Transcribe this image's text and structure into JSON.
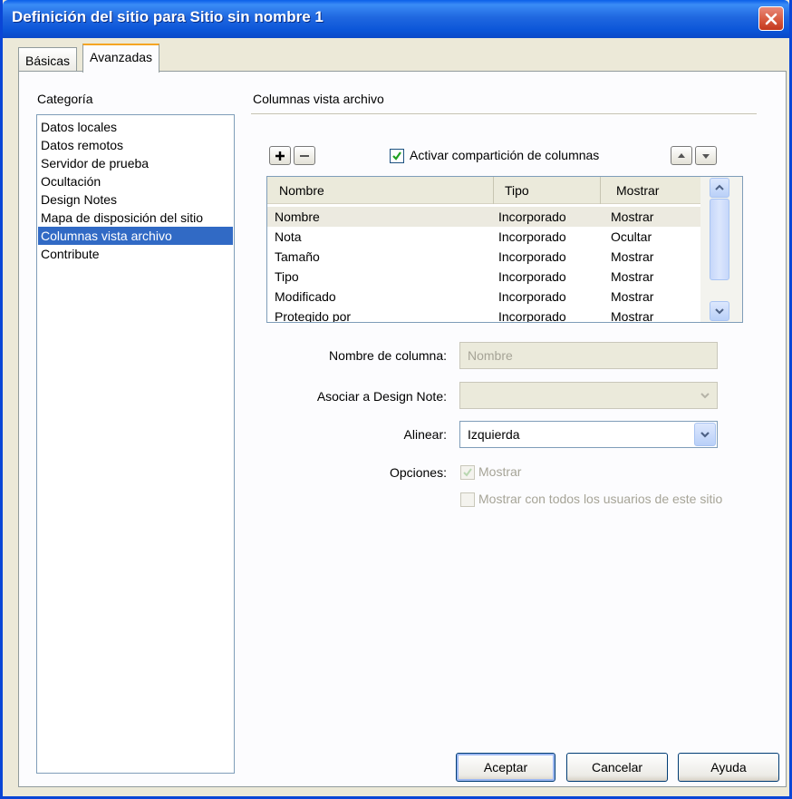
{
  "window": {
    "title": "Definición del sitio para Sitio sin nombre 1"
  },
  "tabs": [
    {
      "label": "Básicas",
      "active": false
    },
    {
      "label": "Avanzadas",
      "active": true
    }
  ],
  "category": {
    "label": "Categoría",
    "items": [
      "Datos locales",
      "Datos remotos",
      "Servidor de prueba",
      "Ocultación",
      "Design Notes",
      "Mapa de disposición del sitio",
      "Columnas vista archivo",
      "Contribute"
    ],
    "selected_index": 6
  },
  "section": {
    "title": "Columnas vista archivo"
  },
  "sharing": {
    "label": "Activar compartición de columnas",
    "checked": true
  },
  "icons": {
    "add": "plus-icon",
    "remove": "minus-icon",
    "up": "arrow-up-icon",
    "down": "arrow-down-icon",
    "close": "close-icon"
  },
  "table": {
    "headers": [
      "Nombre",
      "Tipo",
      "Mostrar"
    ],
    "rows": [
      [
        "Nombre",
        "Incorporado",
        "Mostrar"
      ],
      [
        "Nota",
        "Incorporado",
        "Ocultar"
      ],
      [
        "Tamaño",
        "Incorporado",
        "Mostrar"
      ],
      [
        "Tipo",
        "Incorporado",
        "Mostrar"
      ],
      [
        "Modificado",
        "Incorporado",
        "Mostrar"
      ],
      [
        "Protegido por",
        "Incorporado",
        "Mostrar"
      ]
    ],
    "selected_row": 0
  },
  "form": {
    "column_name_label": "Nombre de columna:",
    "column_name_value": "Nombre",
    "design_note_label": "Asociar a Design Note:",
    "design_note_value": "",
    "align_label": "Alinear:",
    "align_value": "Izquierda",
    "options_label": "Opciones:",
    "show_label": "Mostrar",
    "show_checked": true,
    "show_all_users_label": "Mostrar con todos los usuarios de este sitio",
    "show_all_users_checked": false
  },
  "buttons": {
    "accept": "Aceptar",
    "cancel": "Cancelar",
    "help": "Ayuda"
  },
  "colors": {
    "titlebar": "#0a5ee9",
    "selection": "#316ac5",
    "dialog_bg": "#ece9d8",
    "tab_accent": "#f5a523"
  }
}
